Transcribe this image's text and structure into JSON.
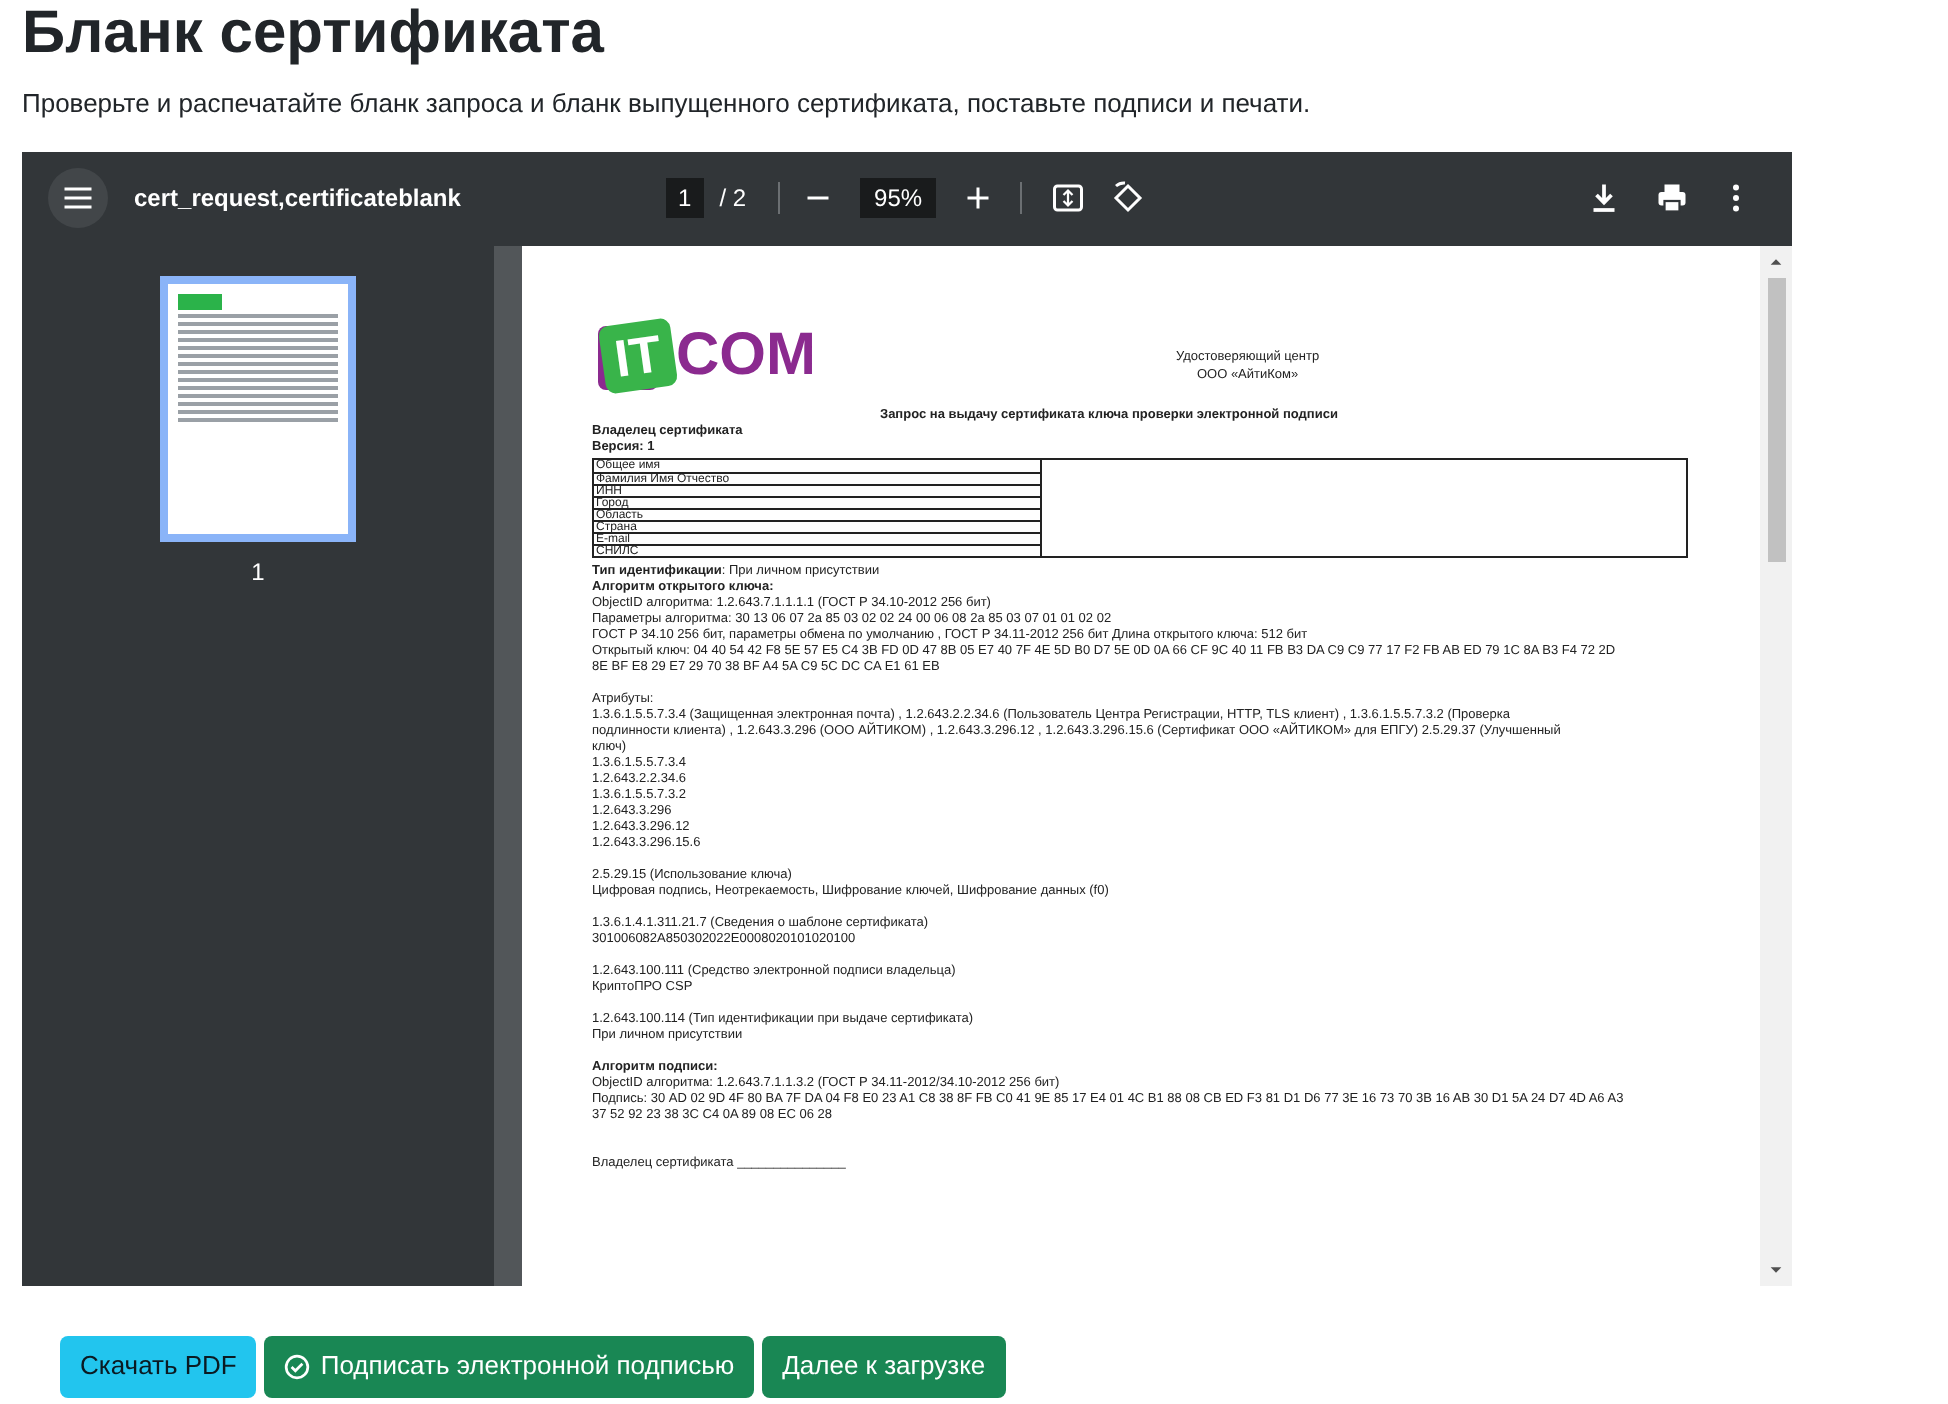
{
  "page": {
    "title": "Бланк сертификата",
    "subtitle": "Проверьте и распечатайте бланк запроса и бланк выпущенного сертификата, поставьте подписи и печати."
  },
  "viewer": {
    "file_name": "cert_request,certificateblank",
    "page_number": "1",
    "page_total": "/ 2",
    "zoom": "95%",
    "thumbnails": [
      {
        "label": "1",
        "selected": true
      }
    ]
  },
  "document": {
    "logo": {
      "left": "IT",
      "right": "COM"
    },
    "issuer": [
      "Удостоверяющий центр",
      "ООО «АйтиКом»"
    ],
    "title": "Запрос на выдачу сертификата ключа проверки электронной подписи",
    "lines_before_table": [
      {
        "text": "Владелец сертификата",
        "kind": "bold"
      },
      {
        "text": "Версия: 1",
        "kind": "bold"
      }
    ],
    "table_rows": [
      "Общее имя",
      "Фамилия Имя Отчество",
      "ИНН",
      "Город",
      "Область",
      "Страна",
      "E-mail",
      "СНИЛС"
    ],
    "lines": [
      {
        "text": "**Тип идентификации**: При личном присутствии",
        "kind": "plain"
      },
      {
        "text": "Алгоритм открытого ключа:",
        "kind": "bold"
      },
      {
        "text": "ObjectID алгоритма: 1.2.643.7.1.1.1.1 (ГОСТ Р 34.10-2012 256 бит)",
        "kind": "plain"
      },
      {
        "text": "Параметры алгоритма: 30 13 06 07 2a 85 03 02 02 24 00 06 08 2a 85 03 07 01 01 02 02",
        "kind": "plain"
      },
      {
        "text": "ГОСТ Р 34.10 256 бит, параметры обмена по умолчанию , ГОСТ Р 34.11-2012 256 бит Длина открытого ключа: 512 бит",
        "kind": "plain"
      },
      {
        "text": "Открытый ключ: 04 40 54 42 F8 5E 57 E5 C4 3B FD 0D 47 8B 05 E7 40 7F 4E 5D B0 D7 5E 0D 0A 66 CF 9C 40 11 FB B3 DA C9 C9 77 17 F2 FB AB ED 79 1C 8A B3 F4 72 2D",
        "kind": "plain"
      },
      {
        "text": "8E BF E8 29 E7 29 70 38 BF A4 5A C9 5C DC CA E1 61 EB",
        "kind": "plain"
      },
      {
        "text": "Атрибуты:",
        "kind": "gap"
      },
      {
        "text": "1.3.6.1.5.5.7.3.4 (Защищенная электронная почта) ,  1.2.643.2.2.34.6 (Пользователь Центра Регистрации, HTTP, TLS клиент) ,  1.3.6.1.5.5.7.3.2 (Проверка",
        "kind": "plain"
      },
      {
        "text": "подлинности клиента) ,  1.2.643.3.296 (ООО АЙТИКОМ) ,  1.2.643.3.296.12 ,  1.2.643.3.296.15.6 (Сертификат ООО «АЙТИКОМ» для ЕПГУ) 2.5.29.37 (Улучшенный",
        "kind": "plain"
      },
      {
        "text": "ключ)",
        "kind": "plain"
      },
      {
        "text": "1.3.6.1.5.5.7.3.4",
        "kind": "plain"
      },
      {
        "text": "1.2.643.2.2.34.6",
        "kind": "plain"
      },
      {
        "text": "1.3.6.1.5.5.7.3.2",
        "kind": "plain"
      },
      {
        "text": "1.2.643.3.296",
        "kind": "plain"
      },
      {
        "text": "1.2.643.3.296.12",
        "kind": "plain"
      },
      {
        "text": "1.2.643.3.296.15.6",
        "kind": "plain"
      },
      {
        "text": "2.5.29.15 (Использование ключа)",
        "kind": "gap"
      },
      {
        "text": "Цифровая подпись, Неотрекаемость, Шифрование ключей, Шифрование данных (f0)",
        "kind": "plain"
      },
      {
        "text": "1.3.6.1.4.1.311.21.7 (Сведения о шаблоне сертификата)",
        "kind": "gap"
      },
      {
        "text": "301006082A850302022E0008020101020100",
        "kind": "plain"
      },
      {
        "text": "1.2.643.100.111 (Средство электронной подписи владельца)",
        "kind": "gap"
      },
      {
        "text": "КриптоПРО CSP",
        "kind": "plain"
      },
      {
        "text": "1.2.643.100.114 (Тип идентификации при выдаче сертификата)",
        "kind": "gap"
      },
      {
        "text": "При личном присутствии",
        "kind": "plain"
      },
      {
        "text": "Алгоритм подписи:",
        "kind": "bold_gap"
      },
      {
        "text": "ObjectID алгоритма: 1.2.643.7.1.1.3.2 (ГОСТ Р 34.11-2012/34.10-2012 256 бит)",
        "kind": "plain"
      },
      {
        "text": "Подпись: 30 AD 02 9D 4F 80 BA 7F DA 04 F8 E0 23 A1 C8 38 8F FB C0 41 9E 85 17 E4 01 4C B1 88 08 CB ED F3 81 D1 D6 77 3E 16 73 70 3B 16 AB 30 D1 5A 24 D7 4D A6 A3",
        "kind": "plain"
      },
      {
        "text": "37 52 92 23 38 3C C4 0A 89 08 EC 06 28",
        "kind": "plain"
      },
      {
        "text": "Владелец сертификата _______________",
        "kind": "big_gap"
      }
    ]
  },
  "buttons": [
    {
      "label": "Скачать PDF",
      "kind": "info"
    },
    {
      "label": "Подписать электронной подписью",
      "kind": "success_icon"
    },
    {
      "label": "Далее к загрузке",
      "kind": "success"
    }
  ]
}
